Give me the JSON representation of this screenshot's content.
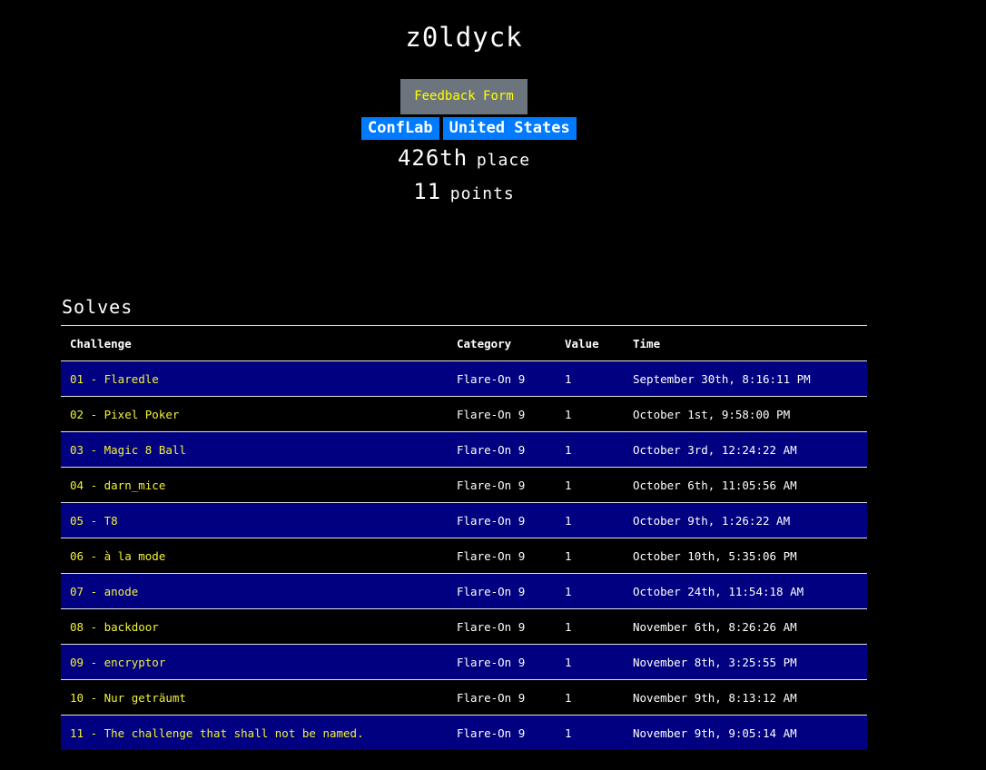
{
  "profile": {
    "username": "z0ldyck",
    "feedback_label": "Feedback Form",
    "badges": [
      "ConfLab",
      "United States"
    ],
    "place_value": "426th",
    "place_label": "place",
    "points_value": "11",
    "points_label": "points"
  },
  "solves": {
    "title": "Solves",
    "headers": {
      "challenge": "Challenge",
      "category": "Category",
      "value": "Value",
      "time": "Time"
    },
    "rows": [
      {
        "challenge": "01 - Flaredle",
        "category": "Flare-On 9",
        "value": "1",
        "time": "September 30th, 8:16:11 PM"
      },
      {
        "challenge": "02 - Pixel Poker",
        "category": "Flare-On 9",
        "value": "1",
        "time": "October 1st, 9:58:00 PM"
      },
      {
        "challenge": "03 - Magic 8 Ball",
        "category": "Flare-On 9",
        "value": "1",
        "time": "October 3rd, 12:24:22 AM"
      },
      {
        "challenge": "04 - darn_mice",
        "category": "Flare-On 9",
        "value": "1",
        "time": "October 6th, 11:05:56 AM"
      },
      {
        "challenge": "05 - T8",
        "category": "Flare-On 9",
        "value": "1",
        "time": "October 9th, 1:26:22 AM"
      },
      {
        "challenge": "06 - à la mode",
        "category": "Flare-On 9",
        "value": "1",
        "time": "October 10th, 5:35:06 PM"
      },
      {
        "challenge": "07 - anode",
        "category": "Flare-On 9",
        "value": "1",
        "time": "October 24th, 11:54:18 AM"
      },
      {
        "challenge": "08 - backdoor",
        "category": "Flare-On 9",
        "value": "1",
        "time": "November 6th, 8:26:26 AM"
      },
      {
        "challenge": "09 - encryptor",
        "category": "Flare-On 9",
        "value": "1",
        "time": "November 8th, 3:25:55 PM"
      },
      {
        "challenge": "10 - Nur geträumt",
        "category": "Flare-On 9",
        "value": "1",
        "time": "November 9th, 8:13:12 AM"
      },
      {
        "challenge": "11 - The challenge that shall not be named.",
        "category": "Flare-On 9",
        "value": "1",
        "time": "November 9th, 9:05:14 AM"
      }
    ]
  },
  "colors": {
    "background": "#000000",
    "row_highlight": "#000080",
    "link_yellow": "#ffff00",
    "badge_blue": "#007bff",
    "button_gray": "#6c757d"
  }
}
